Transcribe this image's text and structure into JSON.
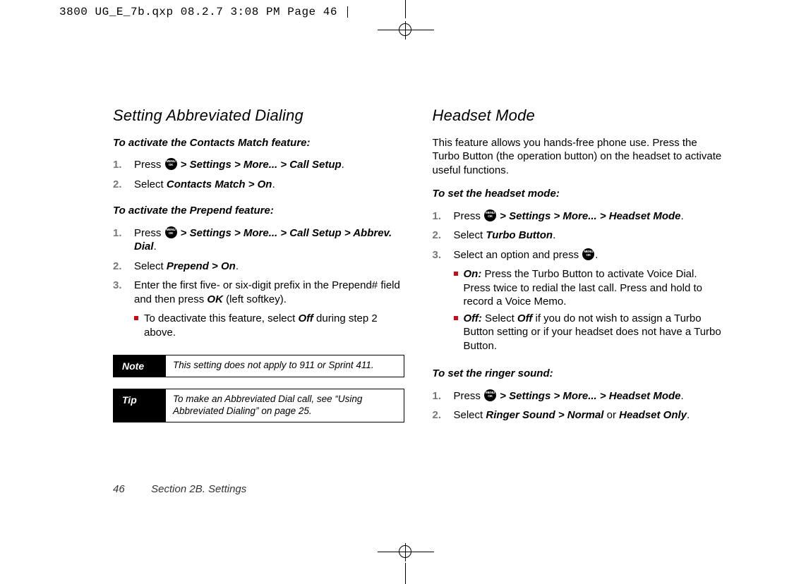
{
  "slug": "3800 UG_E_7b.qxp  08.2.7  3:08 PM  Page 46",
  "left": {
    "heading": "Setting Abbreviated Dialing",
    "lead1": "To activate the Contacts Match feature:",
    "steps1": {
      "s1a": "Press ",
      "s1b": " > Settings > More... > Call Setup",
      "s1c": ".",
      "s2a": "Select ",
      "s2b": "Contacts Match > On",
      "s2c": "."
    },
    "lead2": "To activate the Prepend feature:",
    "steps2": {
      "s1a": "Press ",
      "s1b": " > Settings > More... > Call Setup > Abbrev. Dial",
      "s1c": ".",
      "s2a": "Select ",
      "s2b": "Prepend > On",
      "s2c": ".",
      "s3a": "Enter the first five- or six-digit prefix in the Prepend# field and then press ",
      "s3b": "OK",
      "s3c": " (left softkey).",
      "s3_sub_a": "To deactivate this feature, select ",
      "s3_sub_b": "Off",
      "s3_sub_c": " during step 2 above."
    },
    "note_label": "Note",
    "note_text": "This setting does not apply to 911 or Sprint 411.",
    "tip_label": "Tip",
    "tip_text": "To make an Abbreviated Dial call, see “Using Abbreviated Dialing” on page 25."
  },
  "right": {
    "heading": "Headset Mode",
    "intro": "This feature allows you hands-free phone use. Press the Turbo Button (the operation button) on the headset to activate useful functions.",
    "lead1": "To set the headset mode:",
    "steps1": {
      "s1a": "Press ",
      "s1b": " > Settings > More... > Headset Mode",
      "s1c": ".",
      "s2a": "Select ",
      "s2b": "Turbo Button",
      "s2c": ".",
      "s3a": "Select an option and press ",
      "s3b": ".",
      "on_label": "On:",
      "on_text": " Press the Turbo Button to activate Voice Dial. Press twice to redial the last call. Press and hold to record a Voice Memo.",
      "off_label": "Off:",
      "off_text_a": " Select ",
      "off_text_b": "Off",
      "off_text_c": " if you do not wish to assign a Turbo Button setting or if your headset does not have a Turbo Button."
    },
    "lead2": "To set the ringer sound:",
    "steps2": {
      "s1a": "Press ",
      "s1b": " > Settings > More... > Headset Mode",
      "s1c": ".",
      "s2a": "Select ",
      "s2b": "Ringer Sound > Normal",
      "s2c": " or ",
      "s2d": "Headset Only",
      "s2e": "."
    }
  },
  "footer_page": "46",
  "footer_text": "Section 2B. Settings"
}
